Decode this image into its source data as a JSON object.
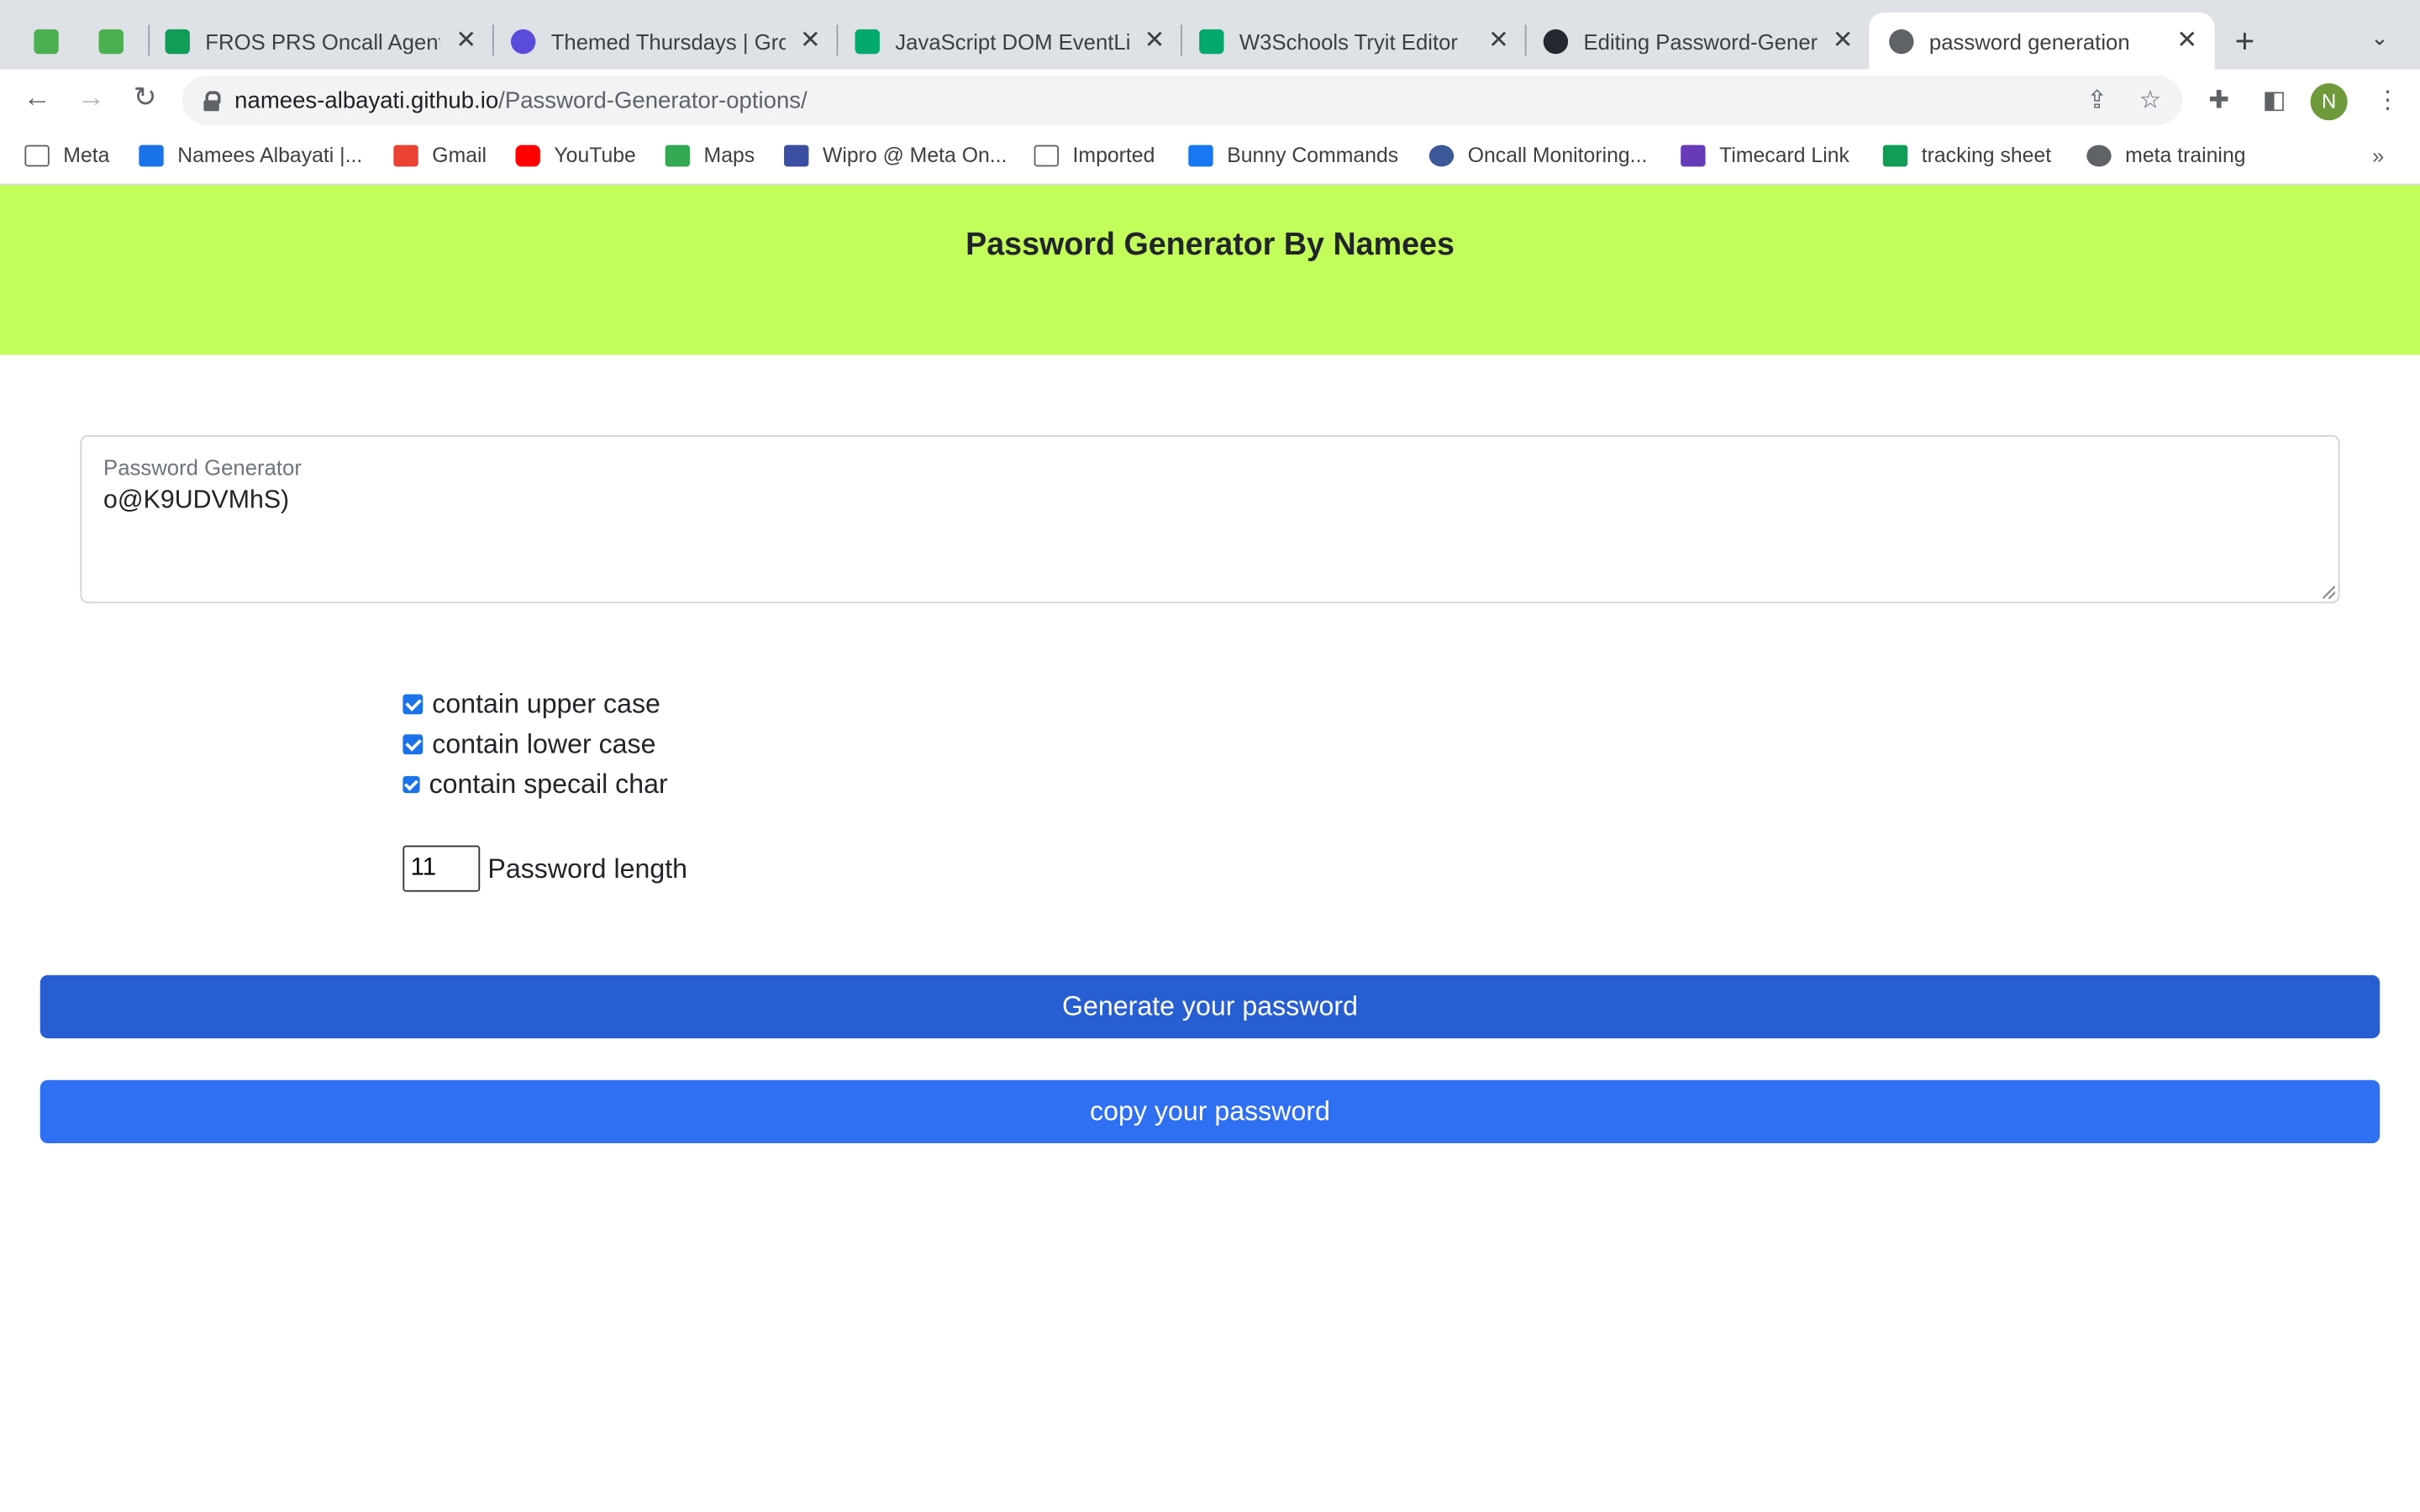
{
  "browser": {
    "tabs": [
      {
        "title": "",
        "active": false
      },
      {
        "title": "",
        "active": false
      },
      {
        "title": "FROS PRS Oncall Agent T",
        "active": false
      },
      {
        "title": "Themed Thursdays | Gro",
        "active": false
      },
      {
        "title": "JavaScript DOM EventLis",
        "active": false
      },
      {
        "title": "W3Schools Tryit Editor",
        "active": false
      },
      {
        "title": "Editing Password-Genera",
        "active": false
      },
      {
        "title": "password generation",
        "active": true
      }
    ],
    "url_host": "namees-albayati.github.io",
    "url_path": "/Password-Generator-options/",
    "profile_initial": "N",
    "bookmarks": [
      "Meta",
      "Namees Albayati |...",
      "Gmail",
      "YouTube",
      "Maps",
      "Wipro @ Meta On...",
      "Imported",
      "Bunny Commands",
      "Oncall Monitoring...",
      "Timecard Link",
      "tracking sheet",
      "meta training"
    ],
    "icons": [
      "back-icon",
      "forward-icon",
      "reload-icon",
      "lock-icon",
      "share-icon",
      "star-icon",
      "extensions-icon",
      "sidepanel-icon",
      "menu-icon"
    ]
  },
  "page": {
    "title": "Password Generator By Namees",
    "password_label": "Password Generator",
    "password_value": "o@K9UDVMhS)",
    "options": [
      {
        "label": "contain upper case",
        "checked": true
      },
      {
        "label": "contain lower case",
        "checked": true
      },
      {
        "label": "contain specail char",
        "checked": true
      }
    ],
    "length_value": "11",
    "length_label": "Password length",
    "generate_label": "Generate your password",
    "copy_label": "copy your password"
  },
  "colors": {
    "header_bg": "#c2fd5a",
    "generate_btn": "#275fd2",
    "copy_btn": "#2f6ff2"
  }
}
